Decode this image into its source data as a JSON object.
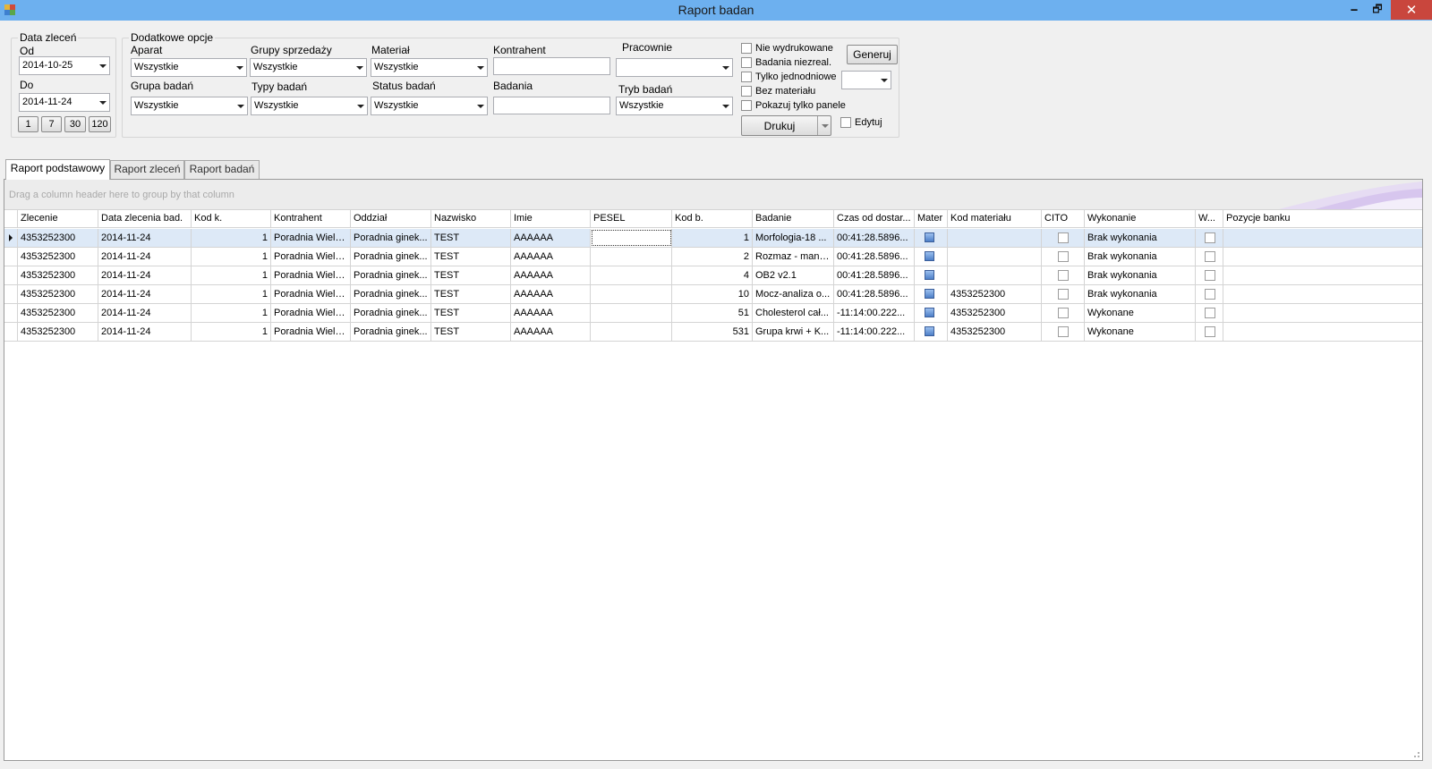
{
  "window": {
    "title": "Raport badan",
    "minimize": "🗕",
    "maximize": "🗗",
    "close": "✕"
  },
  "dates": {
    "group_label": "Data zleceń",
    "from_label": "Od",
    "from_value": "2014-10-25",
    "to_label": "Do",
    "to_value": "2014-11-24",
    "quick_buttons": [
      "1",
      "7",
      "30",
      "120"
    ]
  },
  "options": {
    "group_label": "Dodatkowe opcje",
    "aparat": {
      "label": "Aparat",
      "value": "Wszystkie"
    },
    "grupy_sprzedazy": {
      "label": "Grupy sprzedaży",
      "value": "Wszystkie"
    },
    "material": {
      "label": "Materiał",
      "value": "Wszystkie"
    },
    "kontrahent": {
      "label": "Kontrahent",
      "value": ""
    },
    "pracownie": {
      "label": "Pracownie",
      "value": ""
    },
    "grupa_badan": {
      "label": "Grupa badań",
      "value": "Wszystkie"
    },
    "typy_badan": {
      "label": "Typy badań",
      "value": "Wszystkie"
    },
    "status_badan": {
      "label": "Status badań",
      "value": "Wszystkie"
    },
    "badania": {
      "label": "Badania",
      "value": ""
    },
    "tryb_badan": {
      "label": "Tryb badań",
      "value": "Wszystkie"
    },
    "checkboxes": {
      "nie_wydrukowane": "Nie wydrukowane",
      "badania_niezreal": "Badania niezreal.",
      "tylko_jednodniowe": "Tylko jednodniowe",
      "bez_materialu": "Bez materiału",
      "pokazuj_tylko_panele": "Pokazuj tylko panele",
      "edytuj": "Edytuj"
    },
    "generuj": "Generuj",
    "drukuj": "Drukuj",
    "small_combo_value": ""
  },
  "tabs": [
    "Raport podstawowy",
    "Raport zleceń",
    "Raport badań"
  ],
  "grid": {
    "group_hint": "Drag a column header here to group by that column",
    "columns": [
      "Zlecenie",
      "Data zlecenia bad.",
      "Kod k.",
      "Kontrahent",
      "Oddział",
      "Nazwisko",
      "Imie",
      "PESEL",
      "Kod b.",
      "Badanie",
      "Czas od dostar...",
      "Mater",
      "Kod materiału",
      "CITO",
      "Wykonanie",
      "W...",
      "Pozycje banku"
    ],
    "rows": [
      {
        "zlecenie": "4353252300",
        "data": "2014-11-24",
        "kodk": "1",
        "kontrahent": "Poradnia Wielo...",
        "oddzial": "Poradnia ginek...",
        "nazwisko": "TEST",
        "imie": "AAAAAA",
        "pesel": "",
        "kodb": "1",
        "badanie": "Morfologia-18 ...",
        "czas": "00:41:28.5896...",
        "kodmat": "",
        "wykonanie": "Brak wykonania",
        "pozycje": ""
      },
      {
        "zlecenie": "4353252300",
        "data": "2014-11-24",
        "kodk": "1",
        "kontrahent": "Poradnia Wielo...",
        "oddzial": "Poradnia ginek...",
        "nazwisko": "TEST",
        "imie": "AAAAAA",
        "pesel": "",
        "kodb": "2",
        "badanie": "Rozmaz - manu...",
        "czas": "00:41:28.5896...",
        "kodmat": "",
        "wykonanie": "Brak wykonania",
        "pozycje": ""
      },
      {
        "zlecenie": "4353252300",
        "data": "2014-11-24",
        "kodk": "1",
        "kontrahent": "Poradnia Wielo...",
        "oddzial": "Poradnia ginek...",
        "nazwisko": "TEST",
        "imie": "AAAAAA",
        "pesel": "",
        "kodb": "4",
        "badanie": "OB2 v2.1",
        "czas": "00:41:28.5896...",
        "kodmat": "",
        "wykonanie": "Brak wykonania",
        "pozycje": ""
      },
      {
        "zlecenie": "4353252300",
        "data": "2014-11-24",
        "kodk": "1",
        "kontrahent": "Poradnia Wielo...",
        "oddzial": "Poradnia ginek...",
        "nazwisko": "TEST",
        "imie": "AAAAAA",
        "pesel": "",
        "kodb": "10",
        "badanie": "Mocz-analiza o...",
        "czas": "00:41:28.5896...",
        "kodmat": "4353252300",
        "wykonanie": "Brak wykonania",
        "pozycje": ""
      },
      {
        "zlecenie": "4353252300",
        "data": "2014-11-24",
        "kodk": "1",
        "kontrahent": "Poradnia Wielo...",
        "oddzial": "Poradnia ginek...",
        "nazwisko": "TEST",
        "imie": "AAAAAA",
        "pesel": "",
        "kodb": "51",
        "badanie": "Cholesterol cał...",
        "czas": "-11:14:00.222...",
        "kodmat": "4353252300",
        "wykonanie": "Wykonane",
        "pozycje": ""
      },
      {
        "zlecenie": "4353252300",
        "data": "2014-11-24",
        "kodk": "1",
        "kontrahent": "Poradnia Wielo...",
        "oddzial": "Poradnia ginek...",
        "nazwisko": "TEST",
        "imie": "AAAAAA",
        "pesel": "",
        "kodb": "531",
        "badanie": "Grupa krwi + K...",
        "czas": "-11:14:00.222...",
        "kodmat": "4353252300",
        "wykonanie": "Wykonane",
        "pozycje": ""
      }
    ]
  }
}
